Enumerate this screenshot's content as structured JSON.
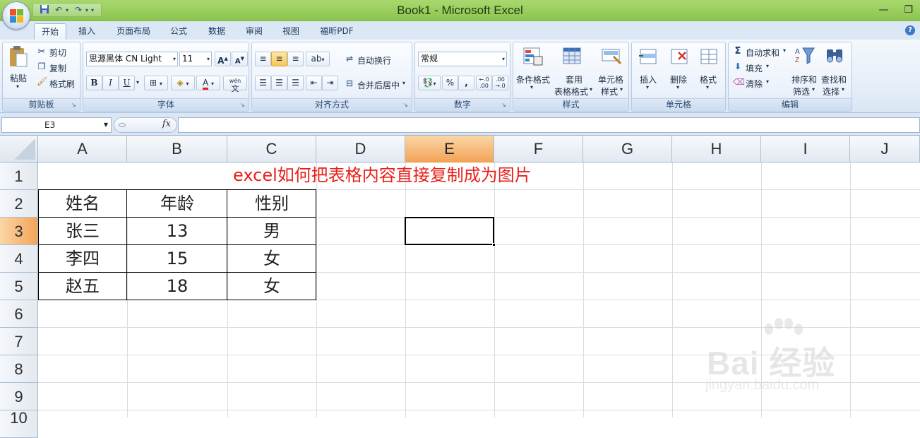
{
  "window": {
    "title": "Book1  -  Microsoft Excel"
  },
  "tabs": [
    "开始",
    "插入",
    "页面布局",
    "公式",
    "数据",
    "审阅",
    "视图",
    "福昕PDF"
  ],
  "ribbon": {
    "clipboard": {
      "label": "剪贴板",
      "paste": "粘贴",
      "cut": "剪切",
      "copy": "复制",
      "format_painter": "格式刷"
    },
    "font": {
      "label": "字体",
      "font_name": "思源黑体 CN Light",
      "font_size": "11",
      "bold": "B",
      "italic": "I",
      "underline": "U",
      "wen": "wén",
      "wen_char": "文"
    },
    "alignment": {
      "label": "对齐方式",
      "wrap": "自动换行",
      "merge": "合并后居中"
    },
    "number": {
      "label": "数字",
      "format": "常规",
      "percent": "%",
      "comma": ",",
      "inc_dec": "+.0\n.00",
      "dec_dec": ".00\n→.0"
    },
    "styles": {
      "label": "样式",
      "conditional": "条件格式",
      "table_fmt_1": "套用",
      "table_fmt_2": "表格格式",
      "cell_style_1": "单元格",
      "cell_style_2": "样式"
    },
    "cells": {
      "label": "单元格",
      "insert": "插入",
      "delete": "删除",
      "format": "格式"
    },
    "editing": {
      "label": "编辑",
      "autosum": "自动求和",
      "fill": "填充",
      "clear": "清除",
      "sort_1": "排序和",
      "sort_2": "筛选",
      "find_1": "查找和",
      "find_2": "选择"
    }
  },
  "formula_bar": {
    "name_box": "E3",
    "fx": "fx",
    "formula": ""
  },
  "columns": [
    "A",
    "B",
    "C",
    "D",
    "E",
    "F",
    "G",
    "H",
    "I",
    "J"
  ],
  "rows": [
    "1",
    "2",
    "3",
    "4",
    "5",
    "6",
    "7",
    "8",
    "9",
    "10"
  ],
  "sheet": {
    "title": "excel如何把表格内容直接复制成为图片",
    "header": [
      "姓名",
      "年龄",
      "性别"
    ],
    "data": [
      [
        "张三",
        "13",
        "男"
      ],
      [
        "李四",
        "15",
        "女"
      ],
      [
        "赵五",
        "18",
        "女"
      ]
    ]
  },
  "watermark": {
    "brand": "Bai 经验",
    "url": "jingyan.baidu.com"
  },
  "colors": {
    "title_bar": "#8cc44f",
    "title_text": "#e8201a",
    "selection": "#f2a458"
  }
}
